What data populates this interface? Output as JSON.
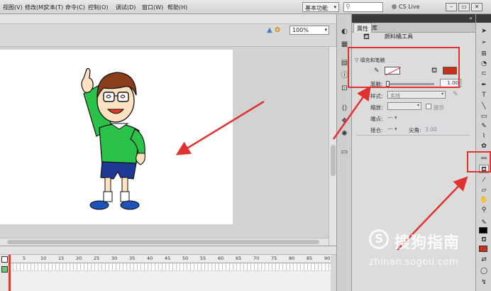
{
  "menu": {
    "items": [
      "视图(V)",
      "修改(M)",
      "文本(T)",
      "命令(C)",
      "控制(O)",
      "调试(D)",
      "窗口(W)",
      "帮助(H)"
    ],
    "workspace": "基本功能",
    "cslive": "CS Live"
  },
  "stage": {
    "zoom": "100%"
  },
  "timeline": {
    "frame_labels": [
      "5",
      "10",
      "15",
      "20",
      "25",
      "30",
      "35",
      "40",
      "45",
      "50",
      "55",
      "60",
      "65",
      "70",
      "75",
      "80",
      "85",
      "90"
    ]
  },
  "properties": {
    "tabs": [
      "属性",
      "库"
    ],
    "tool_name": "颜料桶工具",
    "section_title": "填充和笔触",
    "stroke_label": "笔触:",
    "stroke_value": "1.00",
    "style_label": "样式:",
    "style_value": "实线",
    "scale_label": "缩放:",
    "hint_label": "提示",
    "end_label": "端点:",
    "join_label": "接合:",
    "miter_label": "尖角:",
    "miter_value": "3.00"
  },
  "colors": {
    "fill_color": "#c7301a",
    "annotation_red": "#e2322f"
  },
  "icons": {
    "paint_bucket": "paint-bucket-icon",
    "pencil": "pencil-icon"
  },
  "watermark": {
    "brand": "搜狗指南",
    "url": "zhinan.sogou.com"
  }
}
